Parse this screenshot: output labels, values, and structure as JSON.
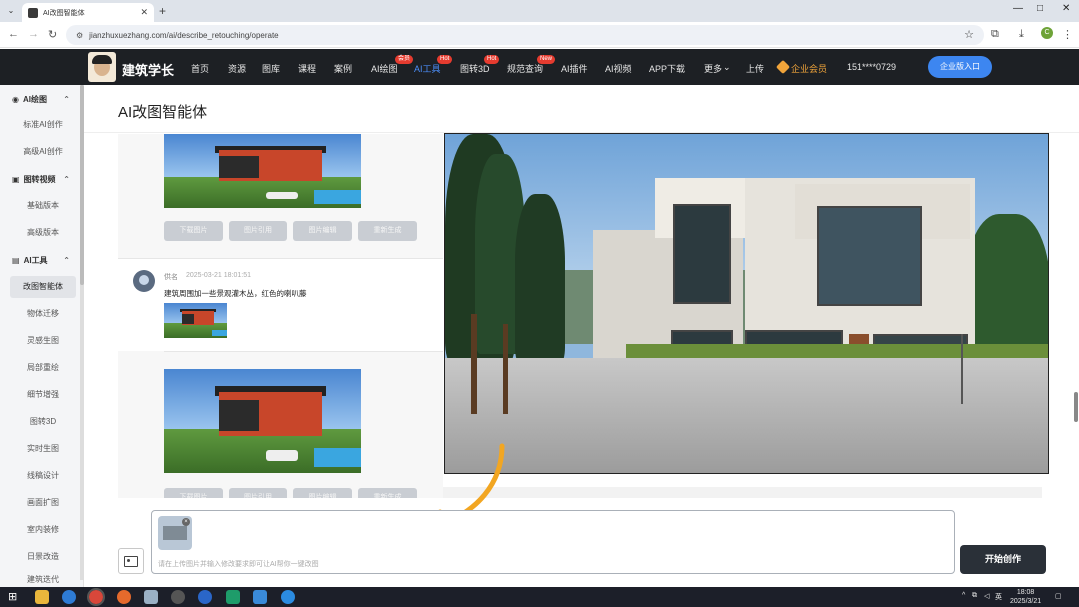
{
  "browser": {
    "tab_title": "AI改图智能体",
    "url": "jianzhuxuezhang.com/ai/describe_retouching/operate",
    "profile_initial": "C"
  },
  "site": {
    "name": "建筑学长",
    "menu": [
      "首页",
      "资源",
      "图库",
      "课程",
      "案例",
      "AI绘图",
      "AI工具",
      "图转3D",
      "规范查询",
      "AI插件",
      "AI视频",
      "APP下载",
      "更多",
      "上传"
    ],
    "badges": {
      "ai_draw": "会员",
      "ai_tools": "Hot",
      "img3d": "Hot",
      "spec": "New"
    },
    "more_chevron": "⌄",
    "enterprise": "企业会员",
    "phone": "151****0729",
    "login_button": "企业版入口"
  },
  "sidebar": {
    "groups": [
      {
        "label": "AI绘图",
        "icon": "eye-icon"
      },
      {
        "label": "图转视频",
        "icon": "video-icon"
      },
      {
        "label": "AI工具",
        "icon": "lock-icon"
      }
    ],
    "items_g1": [
      "标准AI创作",
      "高级AI创作"
    ],
    "items_g2": [
      "基础版本",
      "高级版本"
    ],
    "items_g3": [
      "改图智能体",
      "物体迁移",
      "灵感生图",
      "局部重绘",
      "细节增强",
      "图转3D",
      "实时生图",
      "线稿设计",
      "画面扩图",
      "室内装修",
      "日景改造",
      "建筑迭代"
    ]
  },
  "page": {
    "title": "AI改图智能体"
  },
  "chat": {
    "actions": [
      "下载图片",
      "图片引用",
      "图片编辑",
      "重新生成"
    ],
    "user": "供名",
    "time": "2025-03-21 18:01:51",
    "message": "建筑周围加一些景观灌木丛，红色的喇叭藤"
  },
  "input": {
    "placeholder": "请在上传图片并输入修改要求即可让AI帮你一键改图",
    "submit": "开始创作"
  },
  "taskbar": {
    "time": "18:08",
    "date": "2025/3/21",
    "lang": "英"
  }
}
